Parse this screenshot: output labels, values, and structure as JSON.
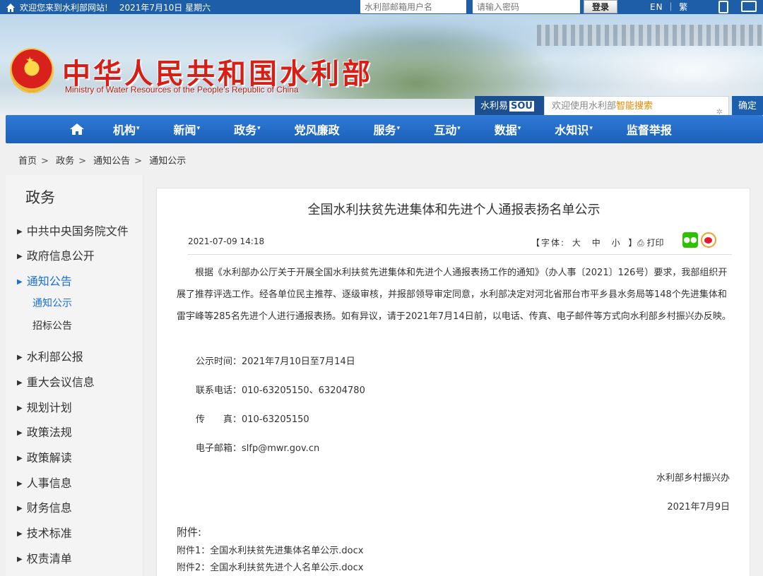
{
  "topbar": {
    "welcome": "欢迎您来到水利部网站!",
    "date": "2021年7月10日 星期六",
    "username_placeholder": "水利部邮箱用户名",
    "password_placeholder": "请输入密码",
    "login_label": "登录",
    "lang_label": "EN ｜ 繁"
  },
  "header": {
    "title": "中华人民共和国水利部",
    "subtitle": "Ministry of Water Resources of the People's Republic of China",
    "search_brand": "水利易",
    "search_brand_sou": "SOU",
    "search_placeholder_prefix": "欢迎使用水利部",
    "search_placeholder_highlight": "智能搜索",
    "search_button": "确定"
  },
  "nav": {
    "items": [
      "机构",
      "新闻",
      "政务",
      "党风廉政",
      "服务",
      "互动",
      "数据",
      "水知识",
      "监督举报"
    ]
  },
  "breadcrumb": [
    "首页",
    "政务",
    "通知公告",
    "通知公示"
  ],
  "sidebar": {
    "title": "政务",
    "items": [
      "中共中央国务院文件",
      "政府信息公开",
      "通知公告",
      "水利部公报",
      "重大会议信息",
      "规划计划",
      "政策法规",
      "政策解读",
      "人事信息",
      "财务信息",
      "技术标准",
      "权责清单"
    ],
    "sub_items": [
      "通知公示",
      "招标公告"
    ]
  },
  "article": {
    "title": "全国水利扶贫先进集体和先进个人通报表扬名单公示",
    "pub_date": "2021-07-09 14:18",
    "font_label": "【字体:",
    "font_large": "大",
    "font_medium": "中",
    "font_small": "小",
    "font_close": "】",
    "print_label": "打印",
    "body": "根据《水利部办公厅关于开展全国水利扶贫先进集体和先进个人通报表扬工作的通知》（办人事〔2021〕126号）要求，我部组织开展了推荐评选工作。经各单位民主推荐、逐级审核，并报部领导审定同意，水利部决定对河北省邢台市平乡县水务局等148个先进集体和雷宇峰等285名先进个人进行通报表扬。如有异议，请于2021年7月14日前，以电话、传真、电子邮件等方式向水利部乡村振兴办反映。",
    "notice_period": "公示时间：2021年7月10日至7月14日",
    "phone": "联系电话：010-63205150、63204780",
    "fax": "传　　真：010-63205150",
    "email": "电子邮箱：slfp@mwr.gov.cn",
    "signature": "水利部乡村振兴办",
    "sign_date": "2021年7月9日",
    "attachments_title": "附件:",
    "attachments": [
      "附件1：全国水利扶贫先进集体名单公示.docx",
      "附件2：全国水利扶贫先进个人名单公示.docx"
    ]
  },
  "colors": {
    "nav_blue": "#2f7ad6",
    "title_red": "#d51f17",
    "active_link": "#1a6fd6"
  }
}
